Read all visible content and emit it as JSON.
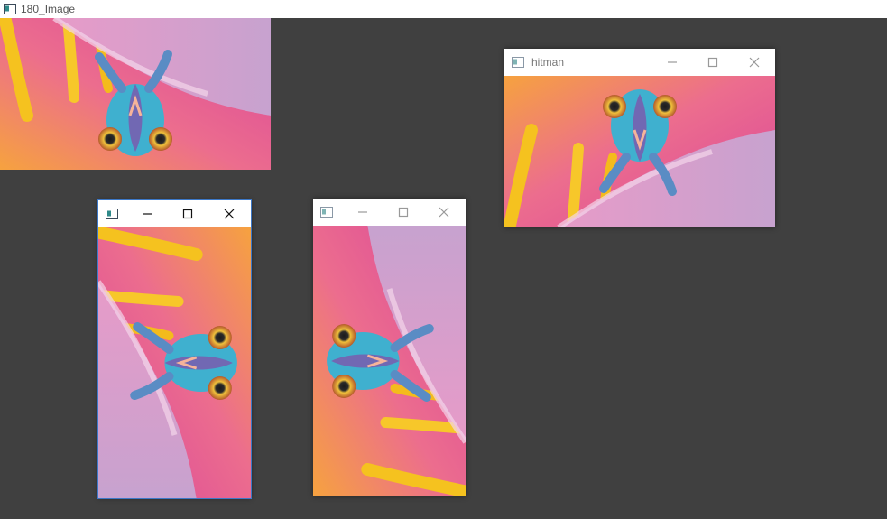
{
  "main_window": {
    "title": "180_Image"
  },
  "windows": [
    {
      "title": ""
    },
    {
      "title": ""
    },
    {
      "title": "hitman"
    }
  ],
  "icons": {
    "app": "window-app-icon",
    "minimize": "minimize-icon",
    "maximize": "maximize-icon",
    "close": "close-icon"
  },
  "colors": {
    "desktop": "#404040",
    "petal_pink": "#e0579a",
    "petal_orange": "#f0a23a",
    "stamen_yellow": "#f5c21f",
    "chameleon_cyan": "#3fb0cf",
    "chameleon_purple": "#7a5cae"
  }
}
